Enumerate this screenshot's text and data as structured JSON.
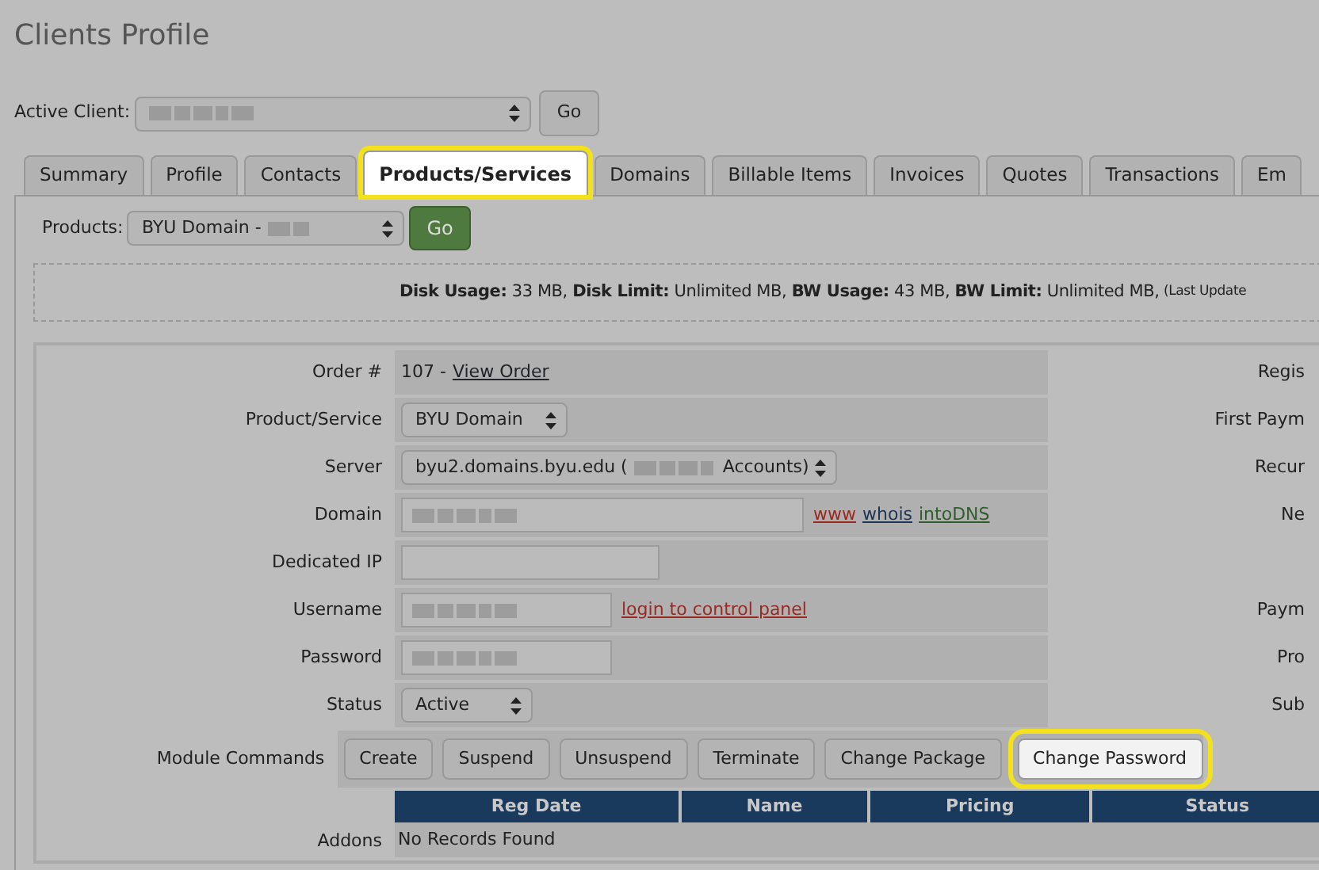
{
  "title": "Clients Profile",
  "active_client": {
    "label": "Active Client:",
    "blurred": true,
    "go": "Go"
  },
  "tabs": [
    {
      "label": "Summary",
      "selected": false
    },
    {
      "label": "Profile",
      "selected": false
    },
    {
      "label": "Contacts",
      "selected": false
    },
    {
      "label": "Products/Services",
      "selected": true
    },
    {
      "label": "Domains",
      "selected": false
    },
    {
      "label": "Billable Items",
      "selected": false
    },
    {
      "label": "Invoices",
      "selected": false
    },
    {
      "label": "Quotes",
      "selected": false
    },
    {
      "label": "Transactions",
      "selected": false
    },
    {
      "label": "Em",
      "selected": false
    }
  ],
  "products": {
    "label": "Products:",
    "value": "BYU Domain -",
    "blurred": true,
    "go": "Go"
  },
  "usage": {
    "text": "**Disk Usage:** 33 MB, **Disk Limit:** Unlimited MB, **BW Usage:** 43 MB, **BW Limit:** Unlimited MB,",
    "note": "(Last Update"
  },
  "fields": [
    {
      "label": "Order #",
      "kind": "order",
      "text": "107 -",
      "link": "View Order",
      "right_label": "Regis"
    },
    {
      "label": "Product/Service",
      "kind": "select",
      "value": "BYU Domain",
      "right_label": "First Paym"
    },
    {
      "label": "Server",
      "kind": "select",
      "value": "byu2.domains.byu.edu (",
      "value_end": "Accounts)",
      "blurred": true,
      "right_label": "Recur"
    },
    {
      "label": "Domain",
      "kind": "input",
      "blurred": true,
      "links": [
        {
          "text": "www",
          "color": "#9a2a22"
        },
        {
          "text": "whois",
          "color": "#1e3556"
        },
        {
          "text": "intoDNS",
          "color": "#2f5e2c"
        }
      ],
      "right_label": "Ne"
    },
    {
      "label": "Dedicated IP",
      "kind": "input",
      "blurred": false
    },
    {
      "label": "Username",
      "kind": "input",
      "blurred": true,
      "links": [
        {
          "text": "login to control panel",
          "color": "#9a2a22"
        }
      ],
      "right_label": "Paym"
    },
    {
      "label": "Password",
      "kind": "input",
      "blurred": true,
      "right_label": "Pro"
    },
    {
      "label": "Status",
      "kind": "select",
      "value": "Active",
      "right_label": "Sub"
    },
    {
      "label": "Module Commands",
      "kind": "buttons",
      "buttons": [
        {
          "label": "Create",
          "highlighted": false
        },
        {
          "label": "Suspend",
          "highlighted": false
        },
        {
          "label": "Unsuspend",
          "highlighted": false
        },
        {
          "label": "Terminate",
          "highlighted": false
        },
        {
          "label": "Change Package",
          "highlighted": false
        },
        {
          "label": "Change Password",
          "highlighted": true
        }
      ]
    }
  ],
  "addons": {
    "label": "Addons",
    "columns": [
      "Reg Date",
      "Name",
      "Pricing",
      "Status"
    ],
    "empty": "No Records Found"
  }
}
